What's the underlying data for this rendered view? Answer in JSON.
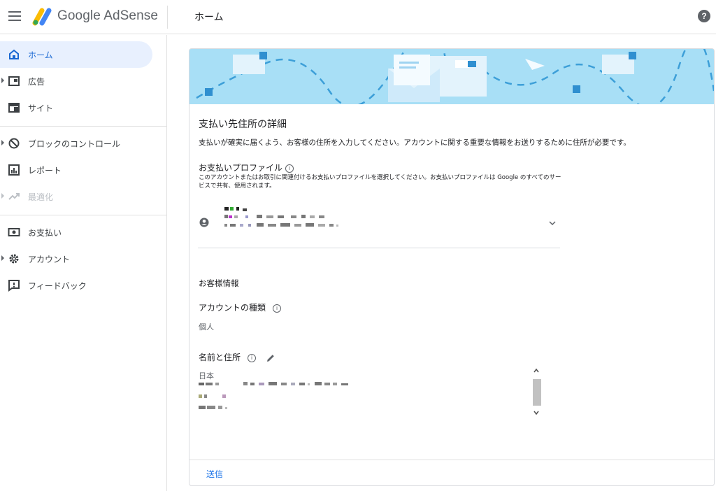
{
  "header": {
    "brand": "Google AdSense",
    "title": "ホーム",
    "help": "?"
  },
  "sidebar": {
    "items": [
      {
        "label": "ホーム",
        "icon": "home-icon",
        "active": true
      },
      {
        "label": "広告",
        "icon": "ads-icon"
      },
      {
        "label": "サイト",
        "icon": "sites-icon"
      },
      {
        "label": "ブロックのコントロール",
        "icon": "block-icon"
      },
      {
        "label": "レポート",
        "icon": "reports-icon"
      },
      {
        "label": "最適化",
        "icon": "optimization-icon",
        "disabled": true
      },
      {
        "label": "お支払い",
        "icon": "payments-icon"
      },
      {
        "label": "アカウント",
        "icon": "gear-icon"
      },
      {
        "label": "フィードバック",
        "icon": "feedback-icon"
      }
    ]
  },
  "card": {
    "title": "支払い先住所の詳細",
    "description": "支払いが確実に届くよう、お客様の住所を入力してください。アカウントに関する重要な情報をお送りするために住所が必要です。",
    "profile_label": "お支払いプロファイル",
    "profile_help": "このアカウントまたはお取引に関連付けるお支払いプロファイルを選択してください。お支払いプロファイルは Google のすべてのサービスで共有、使用されます。",
    "customer_info_heading": "お客様情報",
    "account_type_label": "アカウントの種類",
    "account_type_value": "個人",
    "name_address_label": "名前と住所",
    "address_country": "日本",
    "submit_label": "送信",
    "info_glyph": "i"
  },
  "colors": {
    "accent": "#1a73e8",
    "active_bg": "#e8f0fe",
    "banner": "#a8dff6"
  }
}
